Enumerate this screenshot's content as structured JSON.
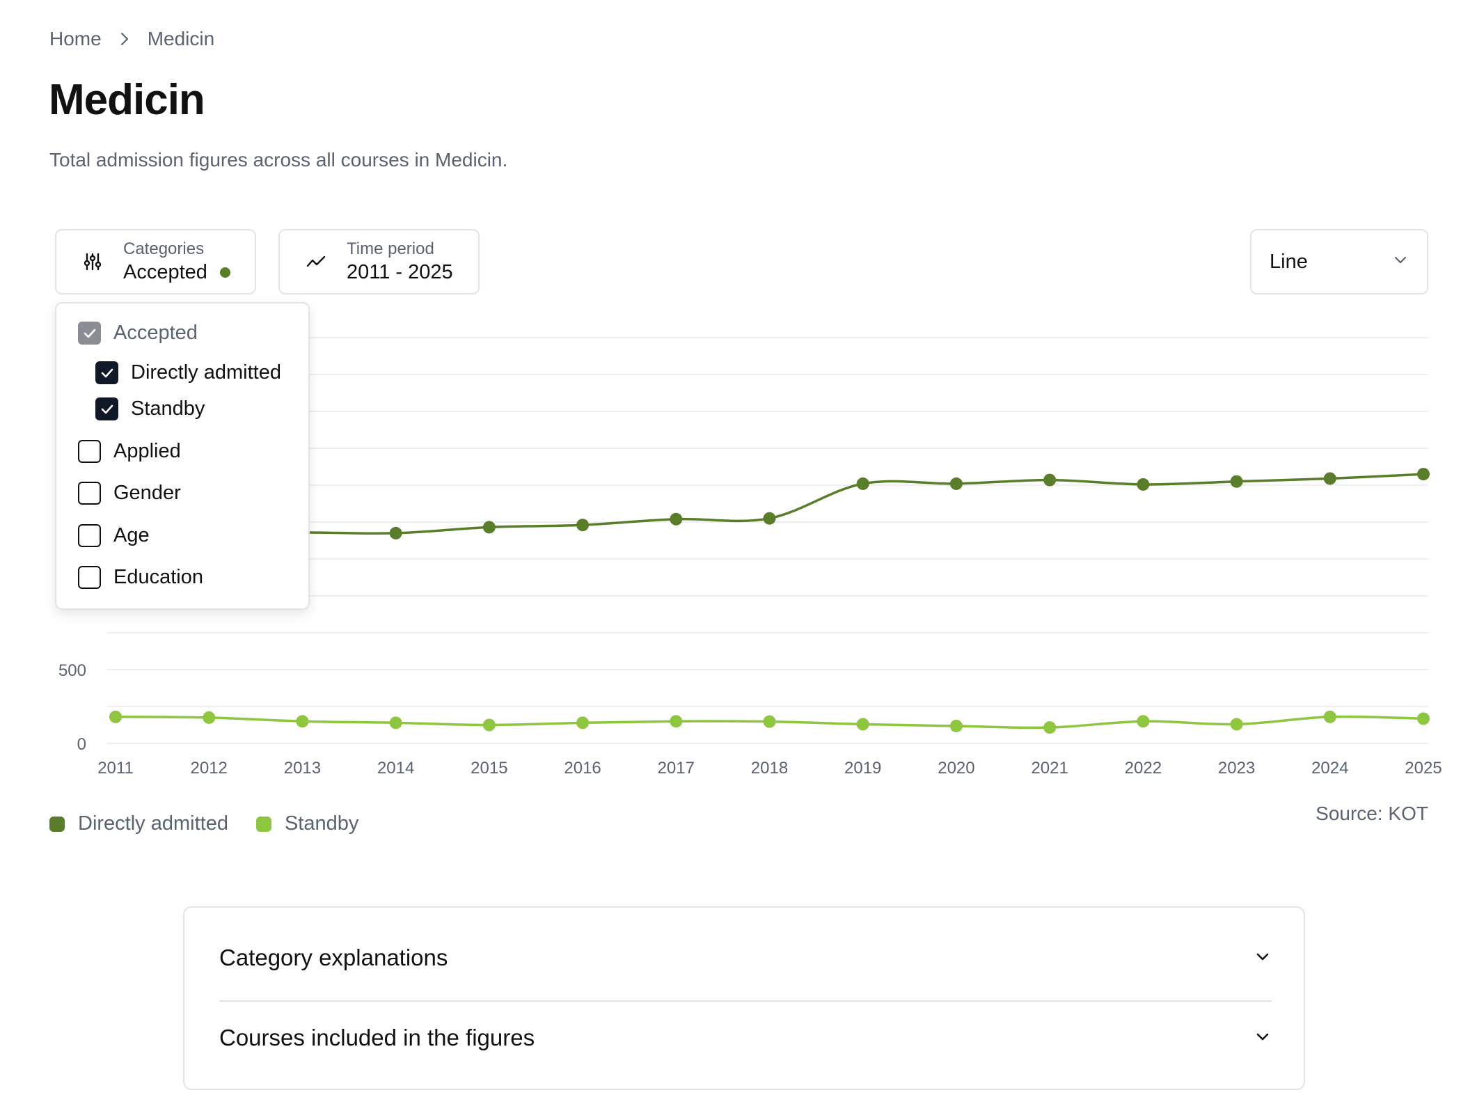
{
  "breadcrumb": {
    "home": "Home",
    "current": "Medicin"
  },
  "page": {
    "title": "Medicin",
    "subtitle": "Total admission figures across all courses in Medicin."
  },
  "controls": {
    "categories": {
      "label": "Categories",
      "value": "Accepted",
      "icon": "sliders-icon"
    },
    "time_period": {
      "label": "Time period",
      "value": "2011 - 2025",
      "icon": "trend-icon"
    },
    "chart_type": {
      "value": "Line",
      "icon": "chevron-down-icon"
    }
  },
  "dropdown": {
    "accepted": {
      "label": "Accepted",
      "state": "indeterminate"
    },
    "directly_admitted": {
      "label": "Directly admitted",
      "checked": true
    },
    "standby": {
      "label": "Standby",
      "checked": true
    },
    "applied": {
      "label": "Applied",
      "checked": false
    },
    "gender": {
      "label": "Gender",
      "checked": false
    },
    "age": {
      "label": "Age",
      "checked": false
    },
    "education": {
      "label": "Education",
      "checked": false
    }
  },
  "legend": {
    "directly_admitted": "Directly admitted",
    "standby": "Standby"
  },
  "source": "Source: KOT",
  "accordion": {
    "item1": "Category explanations",
    "item2": "Courses included in the figures"
  },
  "colors": {
    "dark_green": "#5a7d2a",
    "light_green": "#8ec63f",
    "muted_text": "#5b6270",
    "border": "#e2e4e8"
  },
  "chart_data": {
    "type": "line",
    "x": [
      "2011",
      "2012",
      "2013",
      "2014",
      "2015",
      "2016",
      "2017",
      "2018",
      "2019",
      "2020",
      "2021",
      "2022",
      "2023",
      "2024",
      "2025"
    ],
    "series": [
      {
        "name": "Directly admitted",
        "values": [
          1430,
          1430,
          1430,
          1425,
          1465,
          1480,
          1520,
          1525,
          1760,
          1760,
          1785,
          1755,
          1775,
          1795,
          1825
        ]
      },
      {
        "name": "Standby",
        "values": [
          180,
          175,
          150,
          140,
          125,
          140,
          150,
          148,
          130,
          118,
          108,
          150,
          130,
          180,
          168
        ]
      }
    ],
    "yticks": [
      "0",
      "500"
    ],
    "ylim": [
      0,
      2750
    ],
    "grid": true
  }
}
